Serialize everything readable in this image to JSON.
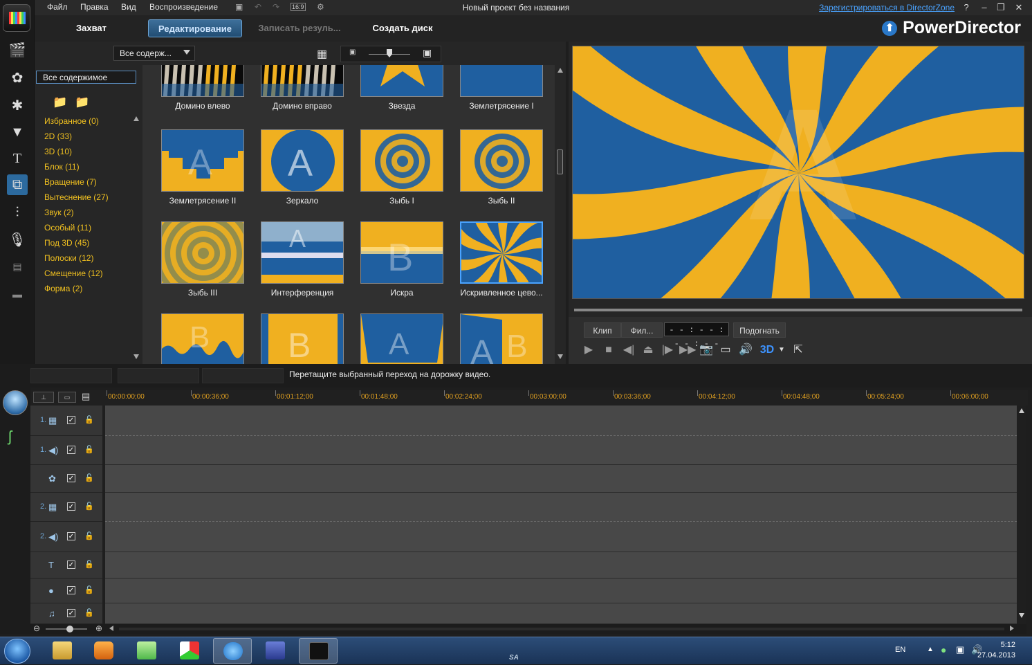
{
  "titlebar": {
    "menus": [
      "Файл",
      "Правка",
      "Вид",
      "Воспроизведение"
    ],
    "aspect": "16:9",
    "title": "Новый проект без названия",
    "register_link": "Зарегистрироваться в DirectorZone",
    "help": "?"
  },
  "modes": {
    "capture": "Захват",
    "edit": "Редактирование",
    "produce": "Записать резуль...",
    "disc": "Создать диск"
  },
  "brand": "PowerDirector",
  "library": {
    "filter_dropdown": "Все содерж...",
    "category_search": "Все содержимое",
    "categories": [
      "Избранное  (0)",
      "2D  (33)",
      "3D  (10)",
      "Блок  (11)",
      "Вращение  (7)",
      "Вытеснение  (27)",
      "Звук  (2)",
      "Особый  (11)",
      "Под 3D  (45)",
      "Полоски  (12)",
      "Смещение  (12)",
      "Форма  (2)"
    ],
    "transitions": [
      {
        "label": "Домино влево",
        "style": "domino-left"
      },
      {
        "label": "Домино вправо",
        "style": "domino-right"
      },
      {
        "label": "Звезда",
        "style": "star"
      },
      {
        "label": "Землетрясение I",
        "style": "quake1"
      },
      {
        "label": "Землетрясение II",
        "style": "quake2"
      },
      {
        "label": "Зеркало",
        "style": "mirror"
      },
      {
        "label": "Зыбь I",
        "style": "ripple1"
      },
      {
        "label": "Зыбь II",
        "style": "ripple2"
      },
      {
        "label": "Зыбь III",
        "style": "ripple3"
      },
      {
        "label": "Интерференция",
        "style": "interf"
      },
      {
        "label": "Искра",
        "style": "spark"
      },
      {
        "label": "Искривленное цево...",
        "style": "swirl"
      },
      {
        "label": "",
        "style": "drip"
      },
      {
        "label": "",
        "style": "bshift"
      },
      {
        "label": "",
        "style": "flip"
      },
      {
        "label": "",
        "style": "page"
      }
    ],
    "selected_index": 11
  },
  "preview": {
    "clip_btn": "Клип",
    "film_btn": "Фил...",
    "timecode": "- - : - - : - - : - -",
    "fit_btn": "Подогнать",
    "three_d": "3D"
  },
  "timeline": {
    "hint": "Перетащите выбранный переход на дорожку видео.",
    "ticks": [
      "00:00:00;00",
      "00:00:36;00",
      "00:01:12;00",
      "00:01:48;00",
      "00:02:24;00",
      "00:03:00;00",
      "00:03:36;00",
      "00:04:12;00",
      "00:04:48;00",
      "00:05:24;00",
      "00:06:00;00"
    ],
    "tracks": [
      {
        "num": "1.",
        "icon": "video-track-icon",
        "glyph": "▦"
      },
      {
        "num": "1.",
        "icon": "audio-track-icon",
        "glyph": "◀)"
      },
      {
        "num": "",
        "icon": "effect-track-icon",
        "glyph": "✿"
      },
      {
        "num": "2.",
        "icon": "video-track-icon",
        "glyph": "▦"
      },
      {
        "num": "2.",
        "icon": "audio-track-icon",
        "glyph": "◀)"
      },
      {
        "num": "",
        "icon": "title-track-icon",
        "glyph": "T"
      },
      {
        "num": "",
        "icon": "voice-track-icon",
        "glyph": "●"
      },
      {
        "num": "",
        "icon": "music-track-icon",
        "glyph": "♫"
      }
    ]
  },
  "taskbar": {
    "lang": "EN",
    "time": "5:12",
    "date": "27.04.2013",
    "watermark": "SA"
  },
  "colors": {
    "accent": "#4aa3ff",
    "category": "#f0c020",
    "transition_blue": "#1f5fa0",
    "transition_yellow": "#f0b020"
  }
}
